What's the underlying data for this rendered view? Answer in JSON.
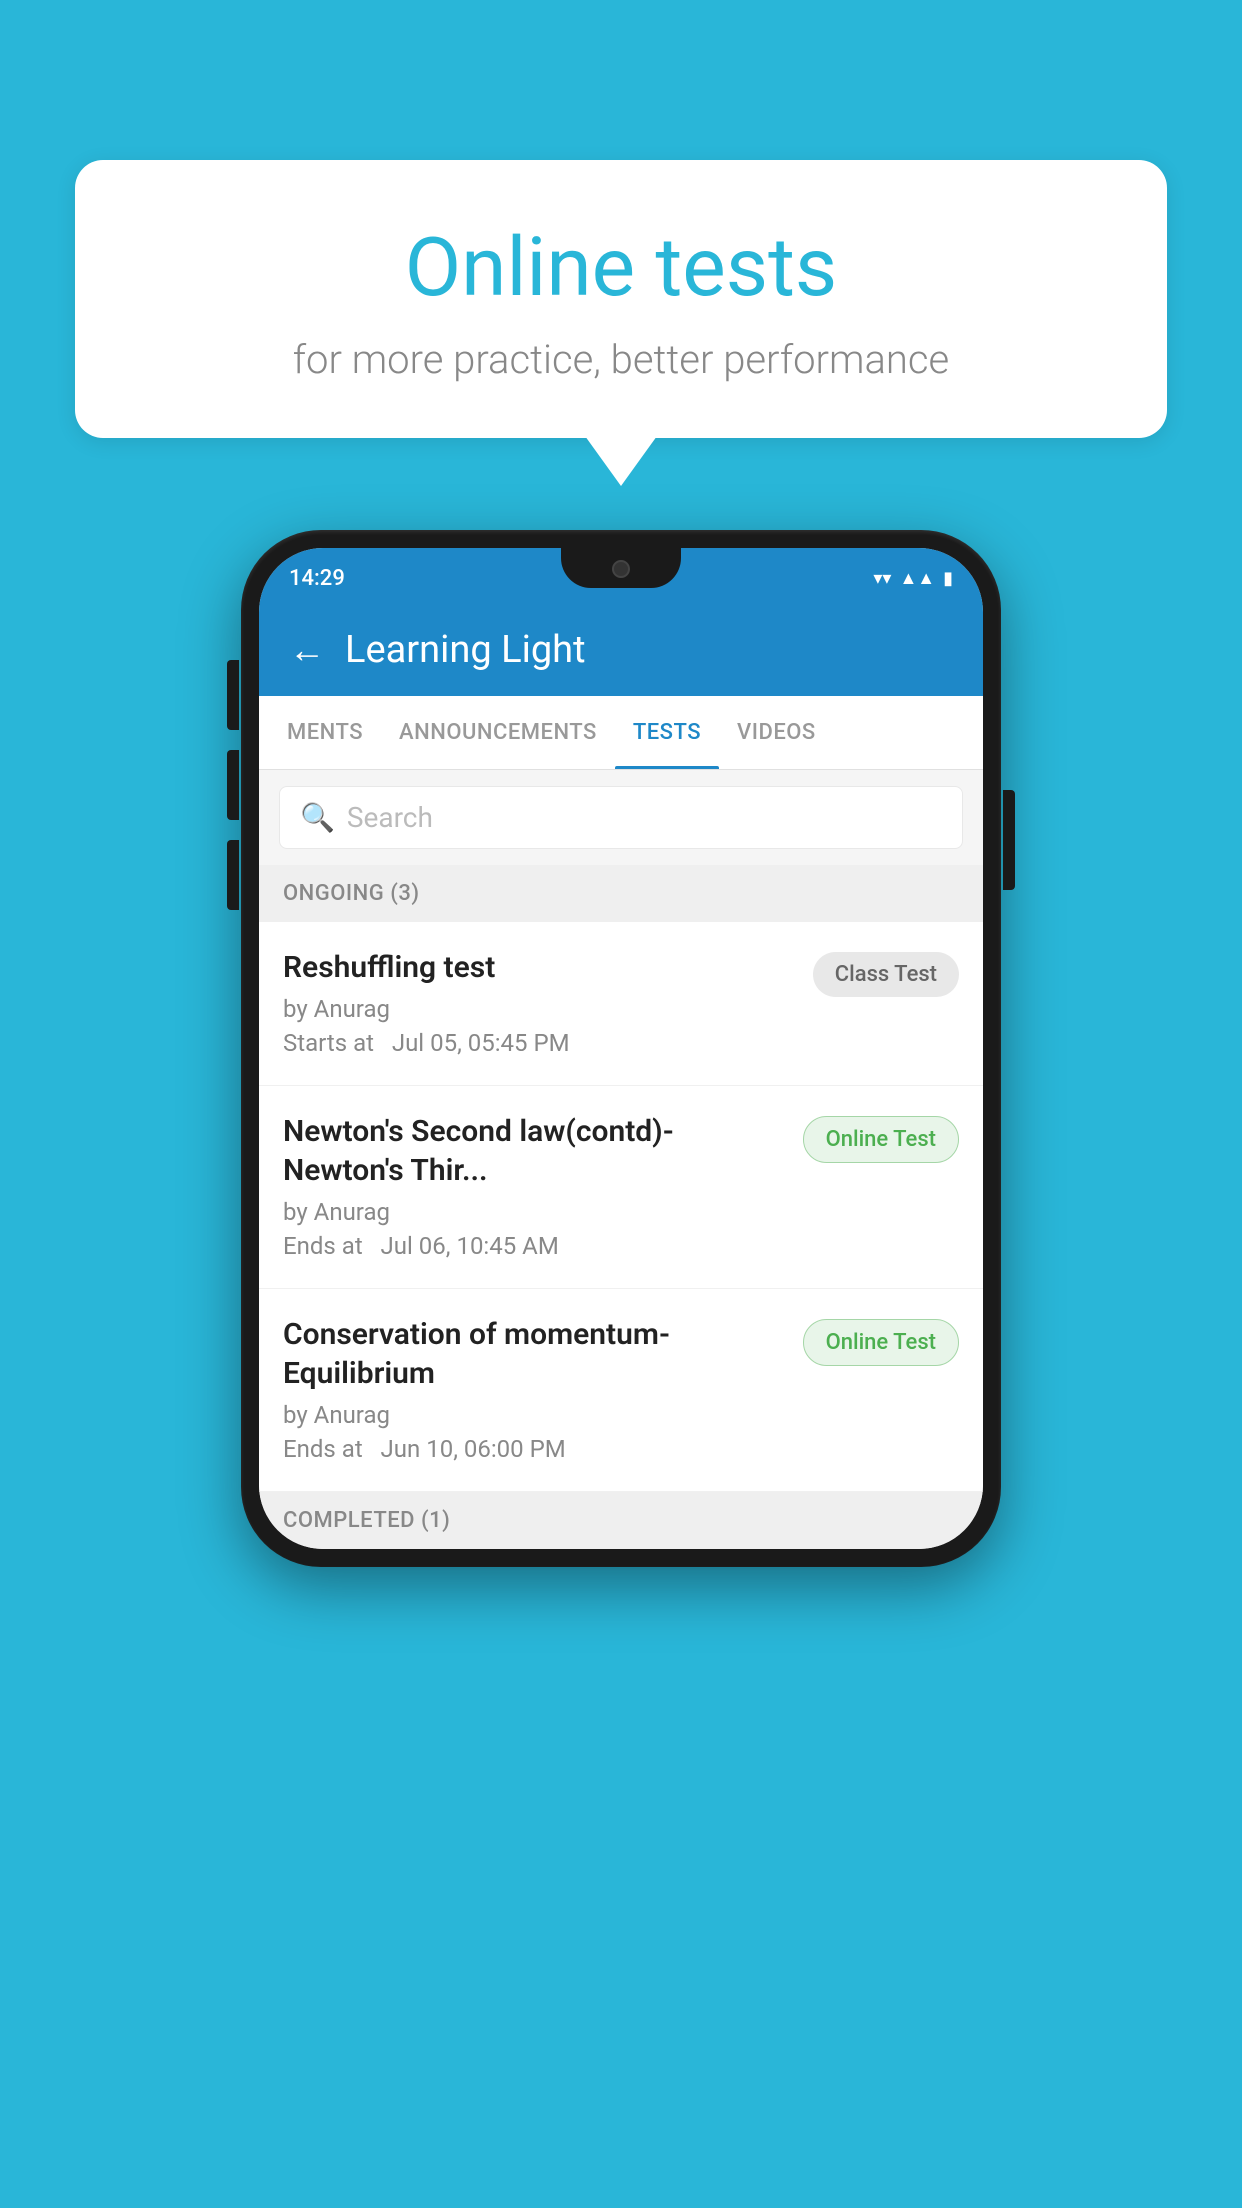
{
  "background": {
    "color": "#29B6D8"
  },
  "speech_bubble": {
    "title": "Online tests",
    "subtitle": "for more practice, better performance"
  },
  "phone": {
    "status_bar": {
      "time": "14:29",
      "wifi": "▾",
      "signal": "▲",
      "battery": "▮"
    },
    "app_header": {
      "back_label": "←",
      "title": "Learning Light"
    },
    "tabs": [
      {
        "label": "MENTS",
        "active": false
      },
      {
        "label": "ANNOUNCEMENTS",
        "active": false
      },
      {
        "label": "TESTS",
        "active": true
      },
      {
        "label": "VIDEOS",
        "active": false
      }
    ],
    "search": {
      "placeholder": "Search"
    },
    "sections": [
      {
        "header": "ONGOING (3)",
        "items": [
          {
            "name": "Reshuffling test",
            "author": "by Anurag",
            "time_label": "Starts at",
            "time_value": "Jul 05, 05:45 PM",
            "badge": "Class Test",
            "badge_type": "class"
          },
          {
            "name": "Newton's Second law(contd)-Newton's Thir...",
            "author": "by Anurag",
            "time_label": "Ends at",
            "time_value": "Jul 06, 10:45 AM",
            "badge": "Online Test",
            "badge_type": "online"
          },
          {
            "name": "Conservation of momentum-Equilibrium",
            "author": "by Anurag",
            "time_label": "Ends at",
            "time_value": "Jun 10, 06:00 PM",
            "badge": "Online Test",
            "badge_type": "online"
          }
        ]
      },
      {
        "header": "COMPLETED (1)",
        "items": []
      }
    ]
  }
}
